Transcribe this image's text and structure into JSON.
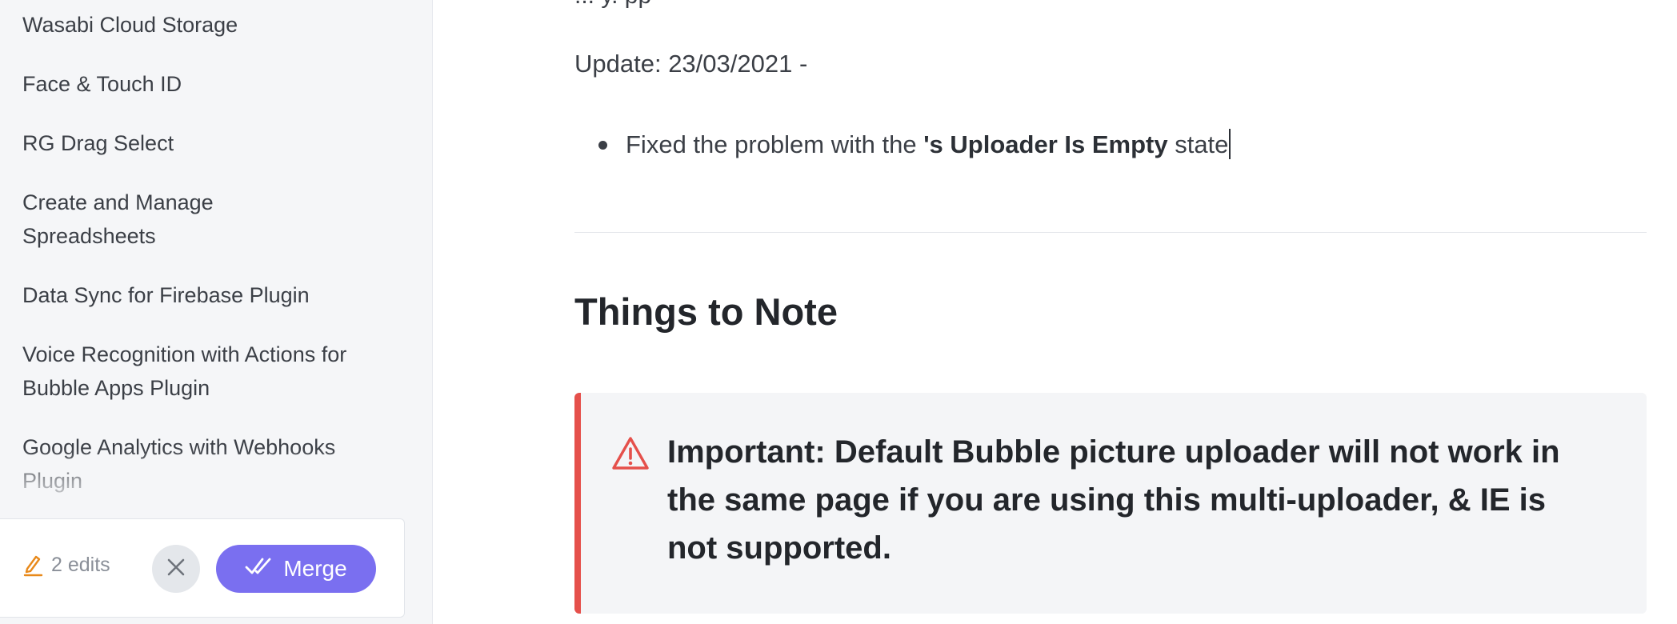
{
  "sidebar": {
    "items": [
      {
        "label": "Wasabi Cloud Storage"
      },
      {
        "label": "Face & Touch ID"
      },
      {
        "label": "RG Drag Select"
      },
      {
        "label": "Create and Manage Spreadsheets"
      },
      {
        "label": "Data Sync for Firebase Plugin"
      },
      {
        "label": "Voice Recognition with Actions for Bubble Apps Plugin"
      },
      {
        "label": "Google Analytics with Webhooks Plugin"
      }
    ]
  },
  "edit_bar": {
    "edits_label": "2 edits",
    "merge_label": "Merge",
    "accent_color": "#7a6ff0",
    "edit_icon_color": "#e8891a"
  },
  "content": {
    "clipped_line": "   ... y. pp",
    "update_line": "Update: 23/03/2021 -",
    "bullets": [
      {
        "prefix": "Fixed the problem with the ",
        "bold": "'s Uploader Is Empty",
        "suffix": " state"
      }
    ],
    "section_title": "Things to Note",
    "callout": {
      "text": "Important: Default Bubble picture uploader will not work in the same page if you are using this multi-uploader, & IE is not supported.",
      "border_color": "#e5504b",
      "icon": "warning-icon"
    }
  }
}
